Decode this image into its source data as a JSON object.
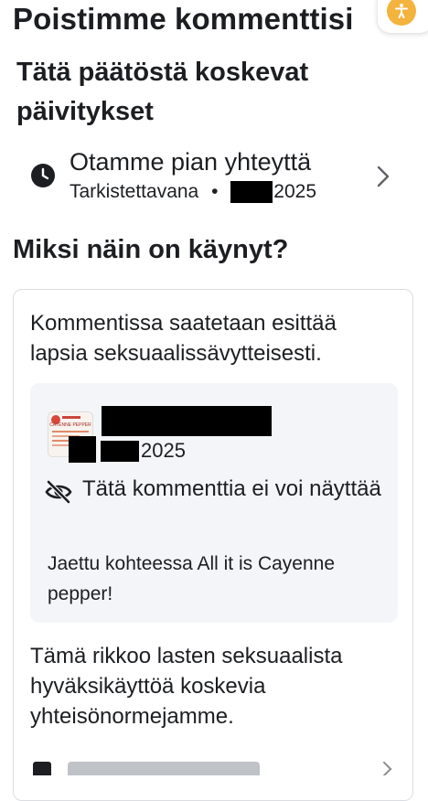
{
  "header": {
    "title": "Poistimme kommenttisi",
    "accessibility_icon": "accessibility-person-icon",
    "accent": "#f3b33d"
  },
  "updates": {
    "heading": "Tätä päätöstä koskevat päivitykset",
    "item": {
      "icon": "clock-icon",
      "title": "Otamme pian yhteyttä",
      "status": "Tarkistettavana",
      "separator": "•",
      "date_suffix": "2025"
    }
  },
  "why": {
    "heading": "Miksi näin on käynyt?",
    "reason": "Kommentissa saatetaan esittää lapsia seksuaalissävytteisesti.",
    "preview": {
      "thumbnail_caption": "CAYENNE PEPPER",
      "date_suffix": "2025",
      "hidden_icon": "eye-slash-icon",
      "hidden_text": "Tätä kommenttia ei voi näyttää",
      "shared_text": "Jaettu kohteessa All it is Cayenne pepper!"
    },
    "rule": "Tämä rikkoo lasten seksuaalista hyväksikäyttöä koskevia yhteisönormejamme."
  }
}
